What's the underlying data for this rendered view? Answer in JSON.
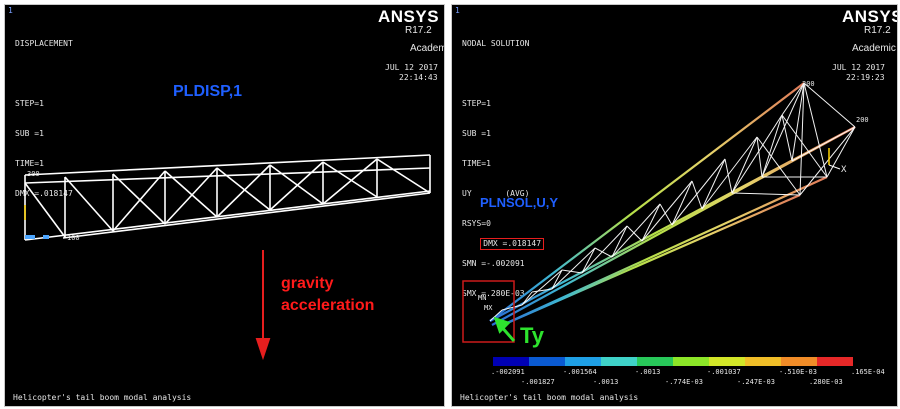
{
  "left_window": {
    "index": "1",
    "header_lines": [
      "DISPLACEMENT",
      "",
      "STEP=1",
      "SUB =1",
      "TIME=1",
      "DMX =.018147"
    ],
    "brand": "ANSYS",
    "version": "R17.2",
    "license": "Academic",
    "date": "JUL 12 2017",
    "time": "22:14:43",
    "command": "PLDISP,1",
    "annotation_line1": "gravity",
    "annotation_line2": "acceleration",
    "node_label_top": "300",
    "node_label_bottom": "100",
    "footer": "Helicopter's tail boom modal analysis"
  },
  "right_window": {
    "index": "1",
    "header_lines": [
      "NODAL SOLUTION",
      "",
      "STEP=1",
      "SUB =1",
      "TIME=1",
      "UY       (AVG)",
      "RSYS=0"
    ],
    "dmx": "DMX =.018147",
    "smn": "SMN =-.002091",
    "smx": "SMX =.280E-03",
    "brand": "ANSYS",
    "version": "R17.2",
    "license": "Academic",
    "date": "JUL 12 2017",
    "time": "22:19:23",
    "command": "PLNSOL,U,Y",
    "ty_label": "Ty",
    "node_label_300": "300",
    "node_label_200": "200",
    "node_label_mn": "MN",
    "node_label_mx": "MX",
    "axis_x": "X",
    "contour_colors": [
      "#0000b4",
      "#0a5ad2",
      "#1fa0e6",
      "#3fd2c8",
      "#28c85a",
      "#8ce628",
      "#d2e628",
      "#f0be28",
      "#f08c28",
      "#e62828"
    ],
    "legend_top": [
      ".-002091",
      "-.001564",
      "-.0013",
      "-.001037",
      "-.510E-03",
      ".165E-04"
    ],
    "legend_bottom": [
      "-.001827",
      "-.0013",
      "-.774E-03",
      "-.247E-03",
      ".280E-03"
    ],
    "footer": "Helicopter's tail boom modal analysis"
  }
}
